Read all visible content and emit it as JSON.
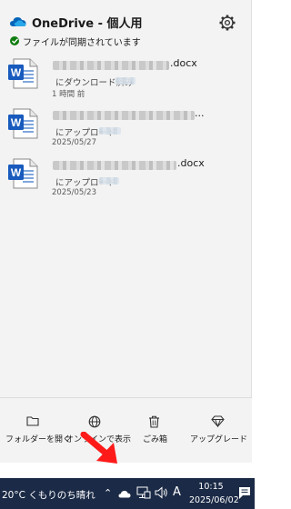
{
  "header": {
    "title": "OneDrive - 個人用",
    "status": "ファイルが同期されています"
  },
  "files": [
    {
      "ext": ".docx",
      "status": "にダウンロード済み",
      "date": "1 時間 前"
    },
    {
      "ext": "...",
      "status": "にアップロード",
      "date": "2025/05/27"
    },
    {
      "ext": ".docx",
      "status": "にアップロード",
      "date": "2025/05/23"
    }
  ],
  "footer": {
    "open_folder": "フォルダーを開く",
    "view_online": "オンラインで表示",
    "recycle_bin": "ごみ箱",
    "upgrade": "アップグレード"
  },
  "taskbar": {
    "weather": "20°C くもりのち晴れ",
    "ime": "A",
    "time": "10:15",
    "date": "2025/06/02"
  },
  "colors": {
    "accent": "#0078d4",
    "ok_green": "#107c10",
    "taskbar": "#1b2a46",
    "arrow": "#ff1a1a"
  },
  "icons": [
    "onedrive-cloud-icon",
    "gear-icon",
    "check-icon",
    "word-doc-icon",
    "folder-icon",
    "globe-icon",
    "trash-icon",
    "diamond-icon"
  ]
}
